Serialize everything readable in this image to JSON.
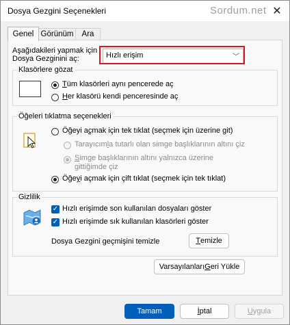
{
  "window": {
    "title": "Dosya Gezgini Seçenekleri",
    "watermark": "Sordum.net"
  },
  "tabs": [
    {
      "label": "Genel"
    },
    {
      "label": "Görünüm"
    },
    {
      "label": "Ara"
    }
  ],
  "open_in": {
    "label_line1": "Aşağıdakileri yapmak için",
    "label_line2": "Dosya Gezginini aç:",
    "selected": "Hızlı erişim"
  },
  "browse_folders": {
    "legend": "Klasörlere gözat",
    "options": [
      {
        "pre": "",
        "accel": "T",
        "post": "üm klasörleri aynı pencerede aç",
        "checked": true
      },
      {
        "pre": "",
        "accel": "H",
        "post": "er klasörü kendi penceresinde aç",
        "checked": false
      }
    ]
  },
  "click_items": {
    "legend": "Öğeleri tıklatma seçenekleri",
    "options": [
      {
        "pre": "Öğeyi a",
        "accel": "ç",
        "post": "mak için tek tıklat (seçmek için üzerine git)",
        "checked": false,
        "disabled": false
      },
      {
        "pre": "Tarayıcım",
        "accel": "l",
        "post": "a tutarlı olan simge başlıklarının altını çiz",
        "checked": false,
        "disabled": true
      },
      {
        "pre": "",
        "accel": "S",
        "post": "imge başlıklarının altını yalnızca üzerine",
        "line2": "gittiğimde çiz",
        "checked": true,
        "disabled": true
      },
      {
        "pre": "Öğe",
        "accel": "y",
        "post": "i açmak için çift tıklat (seçmek için tek tıklat)",
        "checked": true,
        "disabled": false
      }
    ]
  },
  "privacy": {
    "legend": "Gizlilik",
    "checks": [
      {
        "label": "Hızlı erişimde son kullanılan dosyaları göster",
        "checked": true
      },
      {
        "label": "Hızlı erişimde sık kullanılan klasörleri göster",
        "checked": true
      }
    ],
    "clear_label": "Dosya Gezgini geçmişini temizle",
    "clear_button": {
      "accel": "T",
      "rest": "emizle"
    }
  },
  "restore_button": {
    "pre": "Varsayılanları ",
    "accel": "G",
    "post": "eri Yükle"
  },
  "footer": {
    "ok": "Tamam",
    "cancel": {
      "accel": "İ",
      "rest": "ptal"
    },
    "apply": {
      "accel": "U",
      "rest": "ygula"
    }
  },
  "colors": {
    "accent": "#005fb8",
    "highlight_border": "#e0141c",
    "panel_bg": "#f9f9f9",
    "window_bg": "#f0f0f0"
  }
}
